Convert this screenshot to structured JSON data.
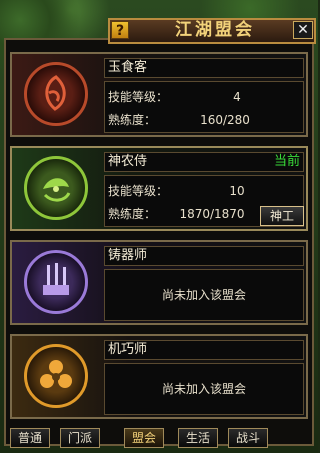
{
  "window": {
    "title": "江湖盟会",
    "help_label": "?",
    "close_label": "✕"
  },
  "guilds": [
    {
      "name": "玉食客",
      "skill_label": "技能等级：",
      "skill_level": "4",
      "exp_label": "熟练度：",
      "exp_value": "160/280",
      "icon": "cooking-emblem-icon"
    },
    {
      "name": "神农侍",
      "current_label": "当前",
      "skill_label": "技能等级：",
      "skill_level": "10",
      "exp_label": "熟练度：",
      "exp_value": "1870/1870",
      "work_button": "神工",
      "icon": "herb-emblem-icon"
    },
    {
      "name": "铸器师",
      "status": "尚未加入该盟会",
      "icon": "forge-emblem-icon"
    },
    {
      "name": "机巧师",
      "status": "尚未加入该盟会",
      "icon": "mechanism-emblem-icon"
    }
  ],
  "tabs": [
    {
      "label": "普通",
      "active": false
    },
    {
      "label": "门派",
      "active": false
    },
    {
      "label": "盟会",
      "active": true
    },
    {
      "label": "生活",
      "active": false
    },
    {
      "label": "战斗",
      "active": false
    }
  ],
  "colors": {
    "current": "#3adc3a",
    "title": "#f2d27a",
    "border": "#7a6a4a"
  }
}
